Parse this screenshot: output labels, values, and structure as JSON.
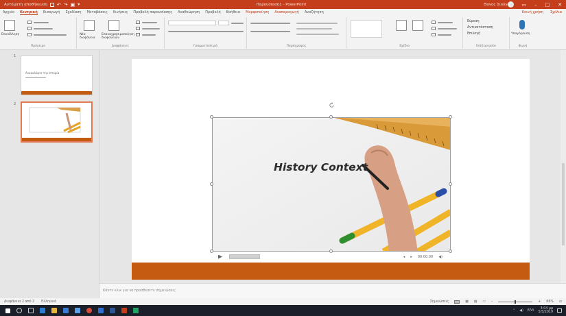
{
  "window": {
    "autosave_label": "Αυτόματη αποθήκευση",
    "title": "Παρουσίαση1 - PowerPoint",
    "user": "Θανος Σιούγας"
  },
  "tabs": [
    {
      "label": "Αρχείο",
      "active": false
    },
    {
      "label": "Κεντρική",
      "active": true
    },
    {
      "label": "Εισαγωγή",
      "active": false
    },
    {
      "label": "Σχεδίαση",
      "active": false
    },
    {
      "label": "Μεταβάσεις",
      "active": false
    },
    {
      "label": "Κινήσεις",
      "active": false
    },
    {
      "label": "Προβολή παρουσίασης",
      "active": false
    },
    {
      "label": "Αναθεώρηση",
      "active": false
    },
    {
      "label": "Προβολή",
      "active": false
    },
    {
      "label": "Βοήθεια",
      "active": false
    },
    {
      "label": "Μορφοποίηση",
      "active": false
    },
    {
      "label": "Αναπαραγωγή",
      "active": false
    }
  ],
  "tabs_right": {
    "share": "Κοινή χρήση",
    "comments": "Σχόλια",
    "search": "Αναζήτηση"
  },
  "ribbon_groups": {
    "clipboard": "Πρόχειρο",
    "slides": "Διαφάνειες",
    "font": "Γραμματοσειρά",
    "paragraph": "Παράγραφος",
    "drawing": "Σχέδιο",
    "editing": "Επεξεργασία",
    "voice": "Φωνή"
  },
  "ribbon_buttons": {
    "paste": "Επικόλληση",
    "new_slide": "Νέα διαφάνεια",
    "reuse": "Επαναχρησιμοποίηση διαφανειών",
    "find": "Εύρεση",
    "replace": "Αντικατάσταση",
    "select": "Επιλογή",
    "dictate": "Υπαγόρευση"
  },
  "slides": [
    {
      "number": "1",
      "text": "Ανακαλύψτε την Ιστορία"
    },
    {
      "number": "2",
      "text": ""
    }
  ],
  "slide": {
    "headline": "History Context",
    "media_time": "00:00.00"
  },
  "notes": {
    "placeholder": "Κάντε κλικ για να προσθέσετε σημειώσεις"
  },
  "status": {
    "slide_info": "Διαφάνεια 2 από 2",
    "language": "Ελληνικά",
    "notes_btn": "Σημειώσεις",
    "zoom": "66%"
  },
  "taskbar": {
    "time": "3:04 μμ",
    "date": "5/5/2019",
    "language": "ΕΛΛ"
  },
  "colors": {
    "accent": "#c43e1c",
    "slide_bar": "#c55a11",
    "taskbar": "#1b1f2a"
  }
}
